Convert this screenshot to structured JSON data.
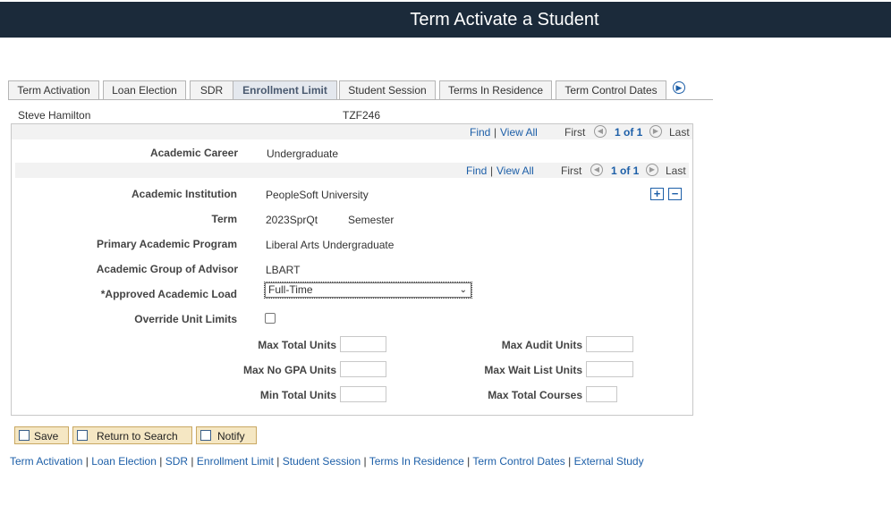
{
  "page": {
    "title": "Term Activate a Student"
  },
  "tabs": [
    {
      "label": "Term Activation",
      "active": false
    },
    {
      "label": "Loan Election",
      "active": false
    },
    {
      "label": "SDR",
      "active": false
    },
    {
      "label": "Enrollment Limit",
      "active": true
    },
    {
      "label": "Student Session",
      "active": false
    },
    {
      "label": "Terms In Residence",
      "active": false
    },
    {
      "label": "Term Control Dates",
      "active": false
    }
  ],
  "tab_next_icon": "▶",
  "student": {
    "name": "Steve Hamilton",
    "id": "TZF246"
  },
  "nav1": {
    "find": "Find",
    "sep": "|",
    "view_all": "View All",
    "first": "First",
    "count": "1 of 1",
    "last": "Last"
  },
  "nav2": {
    "find": "Find",
    "sep": "|",
    "view_all": "View All",
    "first": "First",
    "count": "1 of 1",
    "last": "Last"
  },
  "nav_prev_icon": "◀",
  "nav_next_icon": "▶",
  "career": {
    "label": "Academic Career",
    "value": "Undergraduate"
  },
  "form": {
    "institution_label": "Academic Institution",
    "institution_value": "PeopleSoft University",
    "term_label": "Term",
    "term_value": "2023SprQt",
    "term_desc": "Semester",
    "program_label": "Primary Academic Program",
    "program_value": "Liberal Arts Undergraduate",
    "advisor_label": "Academic Group of Advisor",
    "advisor_value": "LBART",
    "load_label": "*Approved Academic Load",
    "load_value": "Full-Time",
    "override_label": "Override Unit Limits",
    "override_checked": false,
    "max_total_units": "Max Total Units",
    "max_no_gpa_units": "Max No GPA Units",
    "min_total_units": "Min Total Units",
    "max_audit_units": "Max Audit Units",
    "max_wait_list_units": "Max Wait List Units",
    "max_total_courses": "Max Total Courses"
  },
  "row_add_icon": "+",
  "row_delete_icon": "−",
  "buttons": {
    "save": "Save",
    "return": "Return to Search",
    "notify": "Notify"
  },
  "footer_links": [
    "Term Activation",
    "Loan Election",
    "SDR",
    "Enrollment Limit",
    "Student Session",
    "Terms In Residence",
    "Term Control Dates",
    "External Study"
  ],
  "footer_sep": "|",
  "colors": {
    "banner": "#1b2a3a",
    "link": "#1d5fa8",
    "button_bg": "#f5e7c3"
  }
}
